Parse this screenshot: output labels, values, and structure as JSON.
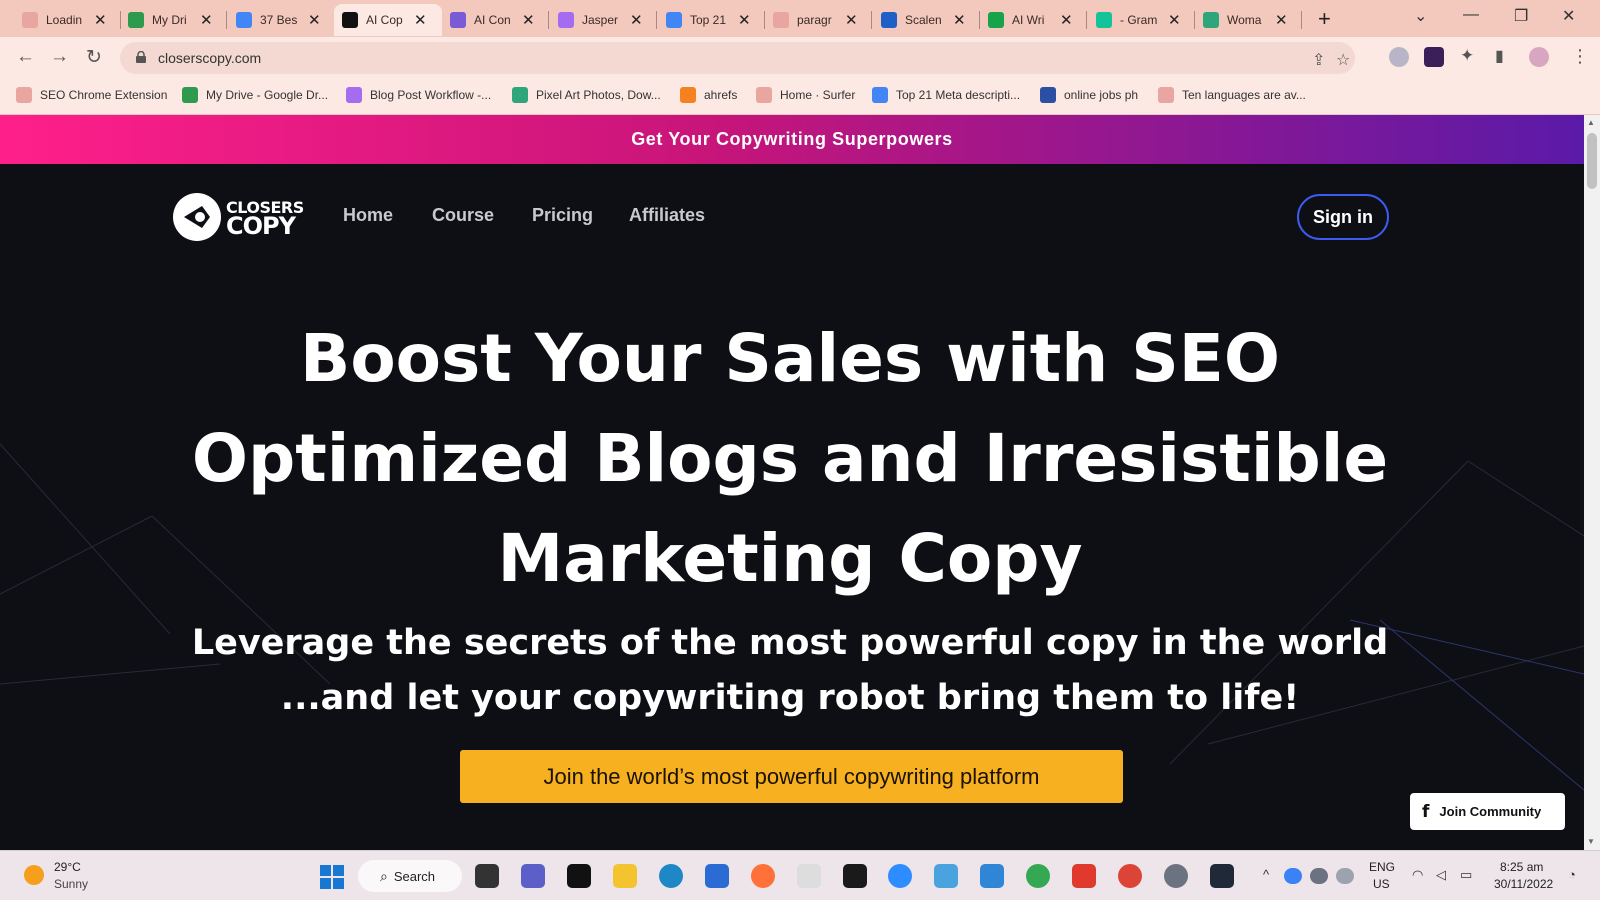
{
  "browser": {
    "tabs": [
      {
        "label": "Loadin",
        "color": "#e9a6a0"
      },
      {
        "label": "My Dri",
        "color": "#2e9a4e"
      },
      {
        "label": "37 Bes",
        "color": "#4285f4"
      },
      {
        "label": "AI Cop",
        "color": "#111111"
      },
      {
        "label": "AI Con",
        "color": "#7a5bd6"
      },
      {
        "label": "Jasper",
        "color": "#a56cf2"
      },
      {
        "label": "Top 21",
        "color": "#4285f4"
      },
      {
        "label": "paragr",
        "color": "#e9a6a0"
      },
      {
        "label": "Scalen",
        "color": "#1f5fc6"
      },
      {
        "label": "AI Wri",
        "color": "#16a34a"
      },
      {
        "label": "- Gram",
        "color": "#15c39a"
      },
      {
        "label": "Woma",
        "color": "#2ea57a"
      }
    ],
    "tab_close": "✕",
    "new_tab": "+",
    "window_controls": {
      "chevron": "⌄",
      "minimize": "—",
      "restore": "❐",
      "close": "✕"
    },
    "nav": {
      "back": "←",
      "forward": "→",
      "reload": "↻"
    },
    "url": "closerscopy.com",
    "icons": {
      "share": "⇪",
      "star": "☆",
      "puzzle": "✦",
      "sidepanel": "▮",
      "menu": "⋮"
    },
    "bookmarks": [
      {
        "label": "SEO Chrome Extension",
        "color": "#e9a6a0"
      },
      {
        "label": "My Drive - Google Dr...",
        "color": "#2e9a4e"
      },
      {
        "label": "Blog Post Workflow -...",
        "color": "#a56cf2"
      },
      {
        "label": "Pixel Art Photos, Dow...",
        "color": "#2ea57a"
      },
      {
        "label": "ahrefs",
        "color": "#f58220"
      },
      {
        "label": "Home · Surfer",
        "color": "#e9a6a0"
      },
      {
        "label": "Top 21 Meta descripti...",
        "color": "#4285f4"
      },
      {
        "label": "online jobs ph",
        "color": "#2b4fa3"
      },
      {
        "label": "Ten languages are av...",
        "color": "#e9a6a0"
      }
    ]
  },
  "site": {
    "banner": "Get Your Copywriting Superpowers",
    "logo": {
      "line1": "CLOSERS",
      "line2": "COPY"
    },
    "nav": [
      "Home",
      "Course",
      "Pricing",
      "Affiliates"
    ],
    "sign_in": "Sign in",
    "headline": "Boost Your Sales with SEO Optimized Blogs and Irresistible Marketing Copy",
    "subheadline_1": "Leverage the secrets of the most powerful copy in the world",
    "subheadline_2": "...and let your copywriting robot bring them to life!",
    "cta": "Join the world’s most powerful copywriting platform",
    "community": "Join Community",
    "community_icon": "f",
    "colors": {
      "banner_start": "#ff1f8a",
      "banner_end": "#5a1aa8",
      "cta": "#f7b01f",
      "signin_border": "#3d5af1",
      "background": "#0e0f14"
    }
  },
  "taskbar": {
    "temperature": "29°C",
    "condition": "Sunny",
    "search": "Search",
    "search_icon": "⌕",
    "lang_1": "ENG",
    "lang_2": "US",
    "time": "8:25 am",
    "date": "30/11/2022",
    "tray_chevron": "^",
    "apps": [
      {
        "name": "task-view",
        "color": "#333333"
      },
      {
        "name": "teams-chat",
        "color": "#5b5fc7"
      },
      {
        "name": "netflix",
        "color": "#111111"
      },
      {
        "name": "file-explorer",
        "color": "#f4c430"
      },
      {
        "name": "edge",
        "color": "#1e88c7"
      },
      {
        "name": "store",
        "color": "#2b6cd4"
      },
      {
        "name": "firefox",
        "color": "#ff7139"
      },
      {
        "name": "amazon",
        "color": "#dddddd"
      },
      {
        "name": "dropbox",
        "color": "#1a1a1a"
      },
      {
        "name": "zoom",
        "color": "#2d8cff"
      },
      {
        "name": "paint",
        "color": "#4aa3df"
      },
      {
        "name": "photos",
        "color": "#2f86d6"
      },
      {
        "name": "chrome-profile",
        "color": "#34a853"
      },
      {
        "name": "wps-office",
        "color": "#e03a2f"
      },
      {
        "name": "chrome",
        "color": "#db4437"
      },
      {
        "name": "settings",
        "color": "#6b7280"
      },
      {
        "name": "norton",
        "color": "#1f2937"
      }
    ]
  }
}
